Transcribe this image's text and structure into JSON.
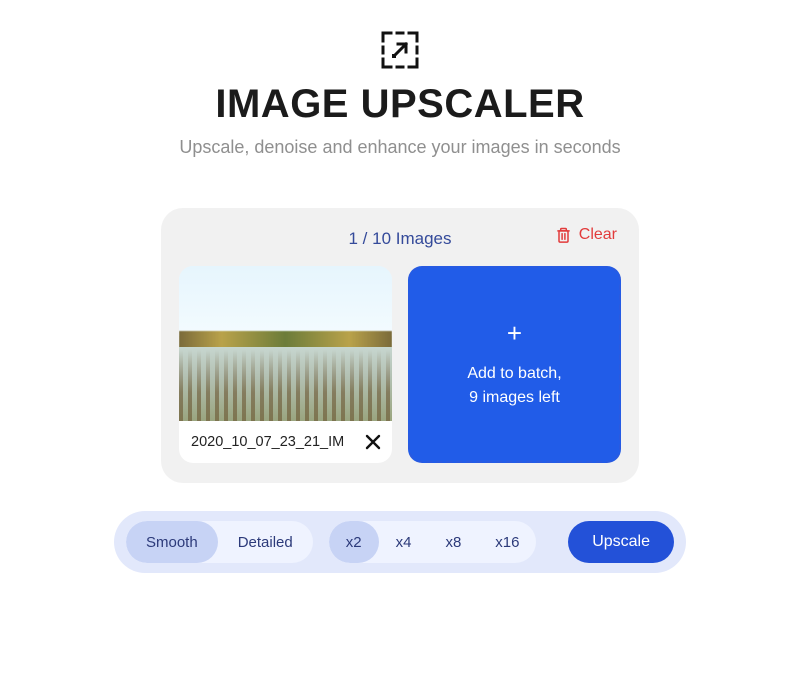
{
  "header": {
    "title": "IMAGE UPSCALER",
    "subtitle": "Upscale, denoise and enhance your images in seconds"
  },
  "panel": {
    "counter": "1 / 10 Images",
    "clear_label": "Clear",
    "thumb": {
      "filename": "2020_10_07_23_21_IM"
    },
    "dropzone": {
      "line1": "Add to batch,",
      "line2": "9 images left"
    }
  },
  "toolbar": {
    "mode": {
      "options": [
        "Smooth",
        "Detailed"
      ],
      "active": "Smooth"
    },
    "scale": {
      "options": [
        "x2",
        "x4",
        "x8",
        "x16"
      ],
      "active": "x2"
    },
    "upscale_label": "Upscale"
  },
  "colors": {
    "accent": "#215ce8",
    "danger": "#e23b3b",
    "panel_bg": "#f1f1f1",
    "toolbar_bg": "#e2e8fb"
  }
}
